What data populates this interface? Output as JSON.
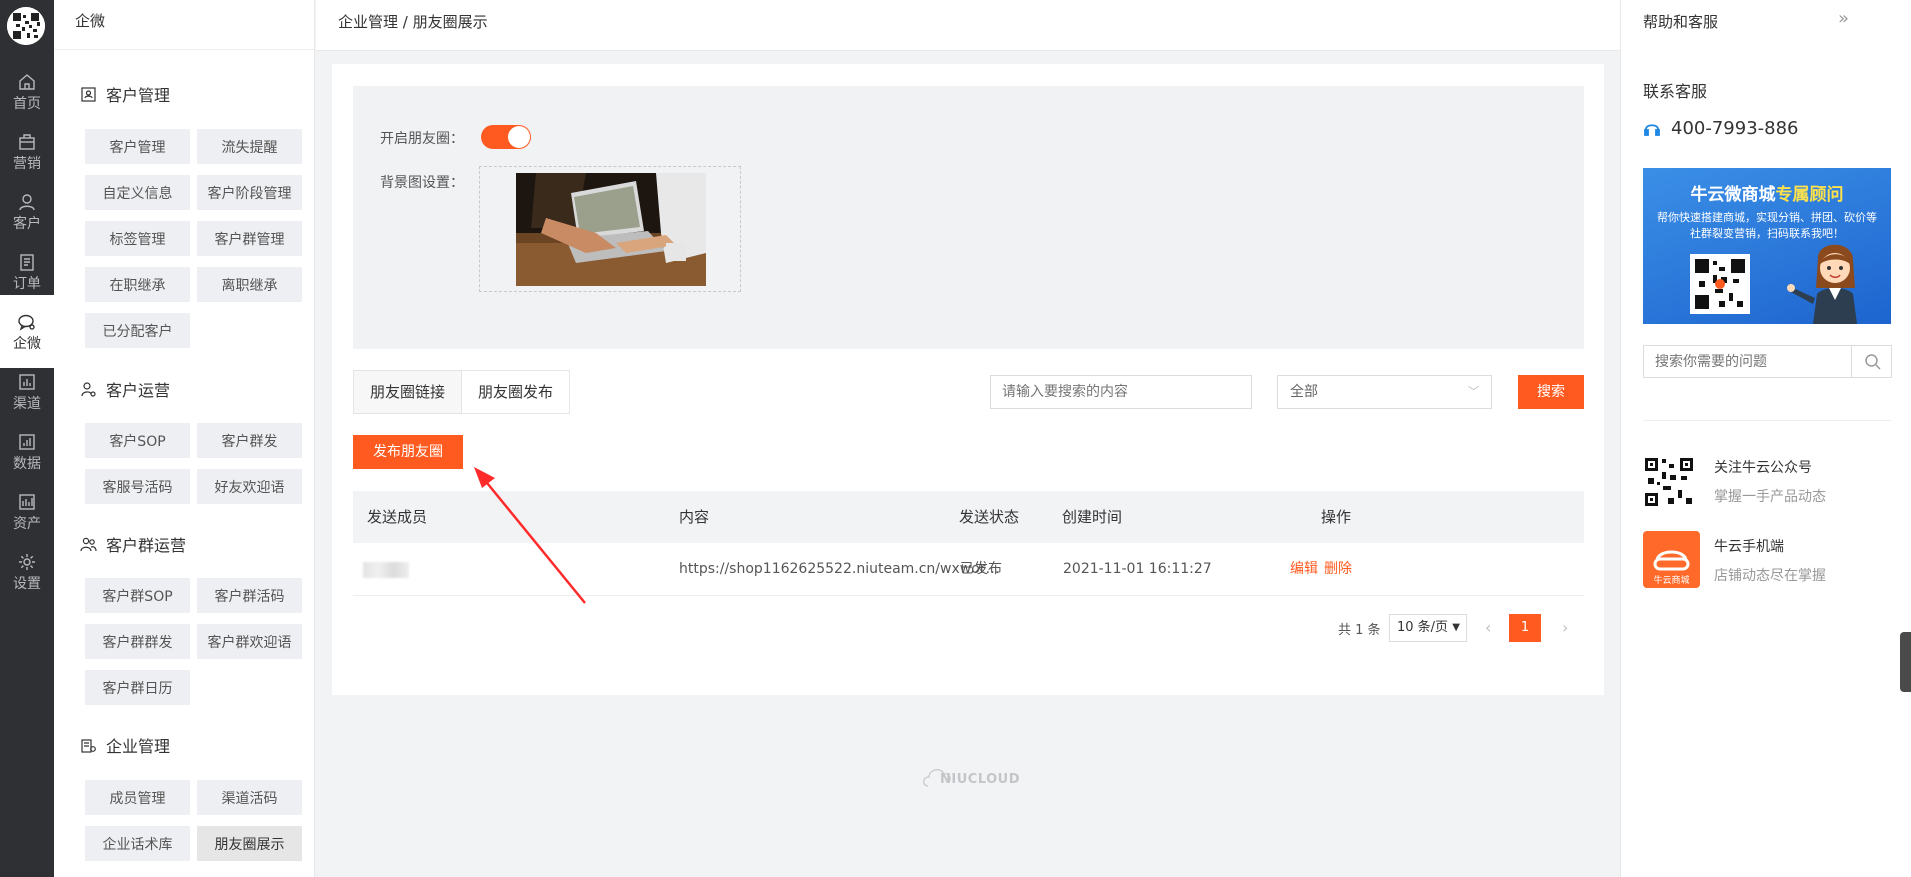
{
  "rail": {
    "items": [
      {
        "label": "首页",
        "icon": "home-icon"
      },
      {
        "label": "营销",
        "icon": "briefcase-icon"
      },
      {
        "label": "客户",
        "icon": "user-icon"
      },
      {
        "label": "订单",
        "icon": "order-list-icon"
      },
      {
        "label": "企微",
        "icon": "wechat-work-icon"
      },
      {
        "label": "渠道",
        "icon": "bar-chart-icon"
      },
      {
        "label": "数据",
        "icon": "data-chart-icon"
      },
      {
        "label": "资产",
        "icon": "asset-chart-icon"
      },
      {
        "label": "设置",
        "icon": "gear-icon"
      }
    ],
    "active": "企微"
  },
  "menu": {
    "title": "企微",
    "groups": [
      {
        "title": "客户管理",
        "items": [
          "客户管理",
          "流失提醒",
          "自定义信息",
          "客户阶段管理",
          "标签管理",
          "客户群管理",
          "在职继承",
          "离职继承",
          "已分配客户"
        ]
      },
      {
        "title": "客户运营",
        "items": [
          "客户SOP",
          "客户群发",
          "客服号活码",
          "好友欢迎语"
        ]
      },
      {
        "title": "客户群运营",
        "items": [
          "客户群SOP",
          "客户群活码",
          "客户群群发",
          "客户群欢迎语",
          "客户群日历"
        ]
      },
      {
        "title": "企业管理",
        "items": [
          "成员管理",
          "渠道活码",
          "企业话术库",
          "朋友圈展示"
        ]
      }
    ],
    "active_item": "朋友圈展示"
  },
  "header": {
    "breadcrumb": "企业管理 / 朋友圈展示"
  },
  "settings": {
    "enable_label": "开启朋友圈：",
    "enable_on": true,
    "bg_label": "背景图设置："
  },
  "tabs": [
    {
      "label": "朋友圈链接",
      "active": false
    },
    {
      "label": "朋友圈发布",
      "active": true
    }
  ],
  "filter": {
    "search_placeholder": "请输入要搜索的内容",
    "status_select": "全部",
    "search_button": "搜索"
  },
  "publish_button": "发布朋友圈",
  "table": {
    "columns": [
      "发送成员",
      "内容",
      "发送状态",
      "创建时间",
      "操作"
    ],
    "rows": [
      {
        "member": "",
        "content": "https://shop1162625522.niuteam.cn/wxwor…",
        "status": "已发布",
        "created": "2021-11-01 16:11:27",
        "actions": [
          "编辑",
          "删除"
        ]
      }
    ]
  },
  "pagination": {
    "total_text": "共 1 条",
    "page_size": "10 条/页",
    "current_page": "1"
  },
  "footer": {
    "logo_text": "NIUCLOUD"
  },
  "right_panel": {
    "title": "帮助和客服",
    "contact_title": "联系客服",
    "phone": "400-7993-886",
    "banner": {
      "title_part1": "牛云微商城",
      "title_part2": "专属顾问",
      "subtitle": "帮你快速搭建商城，实现分销、拼团、砍价等社群裂变营销，扫码联系我吧！"
    },
    "search_placeholder": "搜索你需要的问题",
    "links": [
      {
        "title": "关注牛云公众号",
        "subtitle": "掌握一手产品动态"
      },
      {
        "title": "牛云手机端",
        "subtitle": "店铺动态尽在掌握"
      }
    ],
    "app_icon_label": "牛云商城"
  },
  "colors": {
    "accent": "#ff5b20",
    "rail_bg": "#2f3033"
  }
}
